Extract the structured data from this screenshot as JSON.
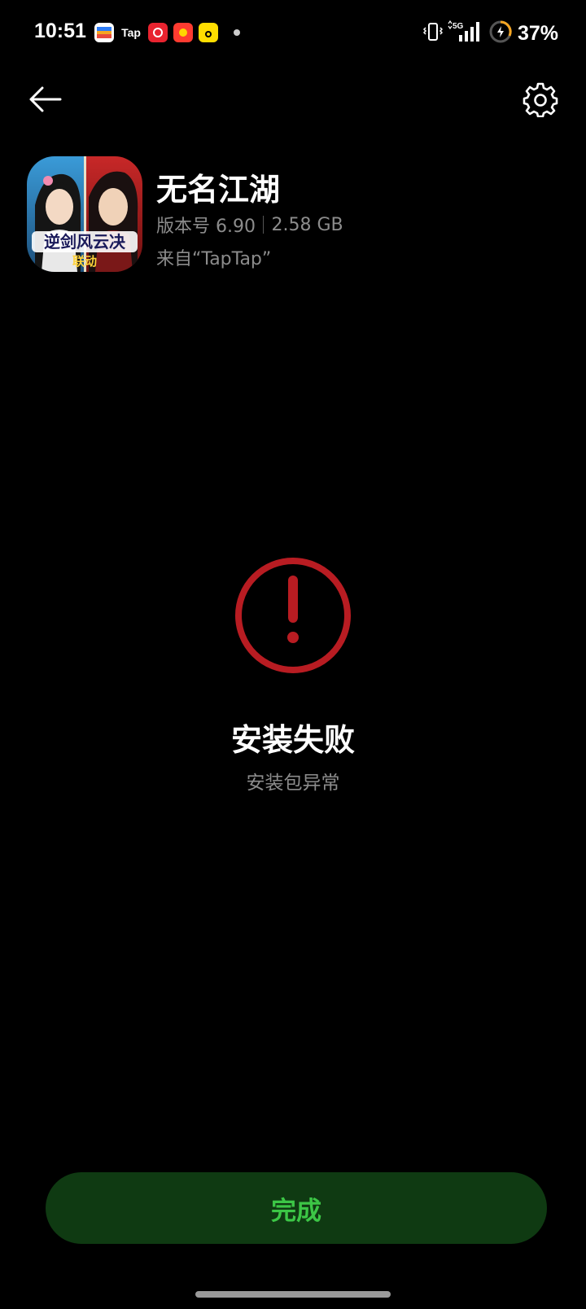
{
  "status_bar": {
    "time": "10:51",
    "notif_tap_label": "Tap",
    "network": "5G",
    "battery_percent": "37%"
  },
  "app": {
    "name": "无名江湖",
    "version": "版本号 6.90",
    "size": "2.58 GB",
    "source": "来自“TapTap”",
    "icon_art_text": "逆剑风云决",
    "icon_art_subtext": "联动"
  },
  "result": {
    "title": "安装失败",
    "message": "安装包异常"
  },
  "actions": {
    "done_label": "完成"
  },
  "colors": {
    "background": "#000000",
    "error_red": "#b81c22",
    "done_button_bg": "#0f3a12",
    "done_button_text": "#3cc646",
    "secondary_text": "#8c8c8c"
  },
  "icons": {
    "back": "arrow-left-icon",
    "settings": "gear-icon",
    "error": "exclamation-circle-icon"
  }
}
